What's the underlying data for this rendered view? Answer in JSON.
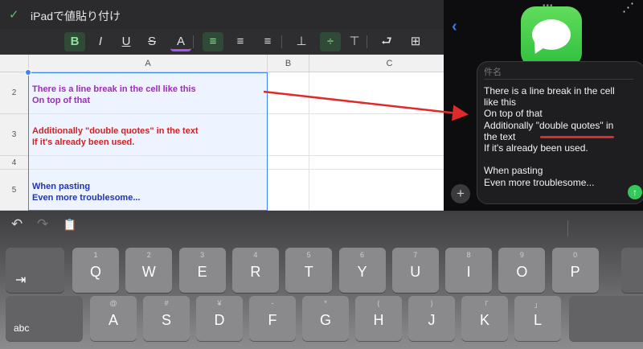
{
  "sheet": {
    "title": "iPadで値貼り付け",
    "check_icon": "✓",
    "toolbar": [
      {
        "glyph": "B",
        "name": "bold-icon",
        "active": true
      },
      {
        "glyph": "I",
        "name": "italic-icon"
      },
      {
        "glyph": "U",
        "name": "underline-icon"
      },
      {
        "glyph": "S",
        "name": "strikethrough-icon"
      },
      {
        "glyph": "A",
        "name": "text-color-icon"
      },
      {
        "glyph": "≡",
        "name": "align-left-icon",
        "active": true
      },
      {
        "glyph": "≡",
        "name": "align-center-icon"
      },
      {
        "glyph": "≡",
        "name": "align-right-icon"
      },
      {
        "glyph": "⊥",
        "name": "valign-bottom-icon"
      },
      {
        "glyph": "÷",
        "name": "valign-middle-icon",
        "active": true
      },
      {
        "glyph": "⊤",
        "name": "valign-top-icon"
      },
      {
        "glyph": "⮐",
        "name": "wrap-text-icon"
      },
      {
        "glyph": "⊞",
        "name": "merge-cells-icon"
      }
    ],
    "columns": [
      "A",
      "B",
      "C"
    ],
    "rows": [
      {
        "num": "2",
        "lines": [
          "There is a line break in the cell like this",
          "On top of that"
        ],
        "color": "#9b2bbd"
      },
      {
        "num": "3",
        "lines": [
          "Additionally \"double quotes\" in the text",
          "If it's already been used."
        ],
        "color": "#d42020"
      },
      {
        "num": "4",
        "lines": [],
        "color": "#000000"
      },
      {
        "num": "5",
        "lines": [
          "When pasting",
          "Even more troublesome..."
        ],
        "color": "#1f33b8"
      }
    ]
  },
  "messages": {
    "subject_placeholder": "件名",
    "body_lines": [
      "There is a line break in the cell",
      "like this",
      "On top of that",
      "Additionally \"double quotes\" in",
      "the text",
      "If it's already been used.",
      "",
      "When pasting",
      "Even more troublesome..."
    ],
    "back_icon": "‹",
    "share_icon": "⋰",
    "plus_label": "+",
    "send_icon": "↑"
  },
  "keyboard": {
    "undo_icon": "↶",
    "redo_icon": "↷",
    "paste_icon": "📋",
    "tab_icon": "⇥",
    "row1": [
      {
        "alt": "1",
        "main": "Q"
      },
      {
        "alt": "2",
        "main": "W"
      },
      {
        "alt": "3",
        "main": "E"
      },
      {
        "alt": "4",
        "main": "R"
      },
      {
        "alt": "5",
        "main": "T"
      },
      {
        "alt": "6",
        "main": "Y"
      },
      {
        "alt": "7",
        "main": "U"
      },
      {
        "alt": "8",
        "main": "I"
      },
      {
        "alt": "9",
        "main": "O"
      },
      {
        "alt": "0",
        "main": "P"
      }
    ],
    "caps_label": "abc",
    "row2": [
      {
        "alt": "@",
        "main": "A"
      },
      {
        "alt": "#",
        "main": "S"
      },
      {
        "alt": "¥",
        "main": "D"
      },
      {
        "alt": "-",
        "main": "F"
      },
      {
        "alt": "*",
        "main": "G"
      },
      {
        "alt": "(",
        "main": "H"
      },
      {
        "alt": ")",
        "main": "J"
      },
      {
        "alt": "「",
        "main": "K"
      },
      {
        "alt": "」",
        "main": "L"
      }
    ]
  },
  "colors": {
    "accent_green": "#34c759",
    "selection_blue": "#3b82f6",
    "annotation_red": "#e02a2a"
  }
}
